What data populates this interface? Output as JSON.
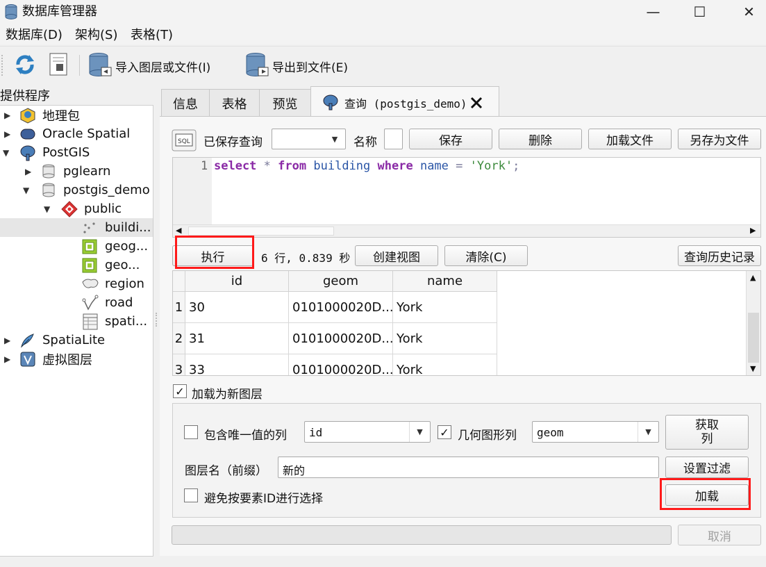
{
  "window": {
    "title": "数据库管理器",
    "minimize": "—",
    "maximize": "☐",
    "close": "✕"
  },
  "menu": [
    "数据库(D)",
    "架构(S)",
    "表格(T)"
  ],
  "toolbar": {
    "import_label": "导入图层或文件(I)",
    "export_label": "导出到文件(E)"
  },
  "tree": {
    "header": "提供程序",
    "items": [
      {
        "label": "地理包",
        "icon": "geopackage-icon"
      },
      {
        "label": "Oracle Spatial",
        "icon": "oracle-icon"
      },
      {
        "label": "PostGIS",
        "icon": "postgis-elephant-icon"
      },
      {
        "label": "pglearn",
        "icon": "database-icon"
      },
      {
        "label": "postgis_demo",
        "icon": "database-icon"
      },
      {
        "label": "public",
        "icon": "schema-icon"
      },
      {
        "label": "buildi...",
        "icon": "point-layer-icon"
      },
      {
        "label": "geog...",
        "icon": "raster-layer-icon"
      },
      {
        "label": "geo...",
        "icon": "raster-layer-icon"
      },
      {
        "label": "region",
        "icon": "polygon-layer-icon"
      },
      {
        "label": "road",
        "icon": "line-layer-icon"
      },
      {
        "label": "spati...",
        "icon": "table-icon"
      },
      {
        "label": "SpatiaLite",
        "icon": "feather-icon"
      },
      {
        "label": "虚拟图层",
        "icon": "virtual-layer-icon"
      }
    ]
  },
  "tabs": [
    "信息",
    "表格",
    "预览",
    "查询 (postgis_demo)"
  ],
  "query": {
    "saved_label": "已保存查询",
    "name_label": "名称",
    "save": "保存",
    "delete": "删除",
    "load_file": "加载文件",
    "save_as_file": "另存为文件",
    "line_number": "1",
    "sql": {
      "select": "select",
      "star": "*",
      "from": "from",
      "table": "building",
      "where": "where",
      "col": "name",
      "eq": "=",
      "value": "'York'",
      "semi": ";"
    },
    "execute": "执行",
    "status": "6 行, 0.839 秒",
    "create_view": "创建视图",
    "clear": "清除(C)",
    "history": "查询历史记录"
  },
  "results": {
    "columns": [
      "id",
      "geom",
      "name"
    ],
    "rows": [
      {
        "n": "1",
        "id": "30",
        "geom": "0101000020D...",
        "name": "York"
      },
      {
        "n": "2",
        "id": "31",
        "geom": "0101000020D...",
        "name": "York"
      },
      {
        "n": "3",
        "id": "33",
        "geom": "0101000020D...",
        "name": "York"
      }
    ]
  },
  "load": {
    "load_as_layer": "加载为新图层",
    "unique_col_label": "包含唯一值的列",
    "unique_col_value": "id",
    "geom_col_label": "几何图形列",
    "geom_col_value": "geom",
    "fetch_cols": "获取\n列",
    "layer_name_label": "图层名（前缀）",
    "layer_name_value": "新的",
    "set_filter": "设置过滤",
    "avoid_select_label": "避免按要素ID进行选择",
    "load_button": "加载",
    "cancel": "取消"
  },
  "colors": {
    "highlight": "#ff1a1a",
    "keyword": "#8a2aa6",
    "identifier": "#2a55a6",
    "string": "#3c8a3c"
  }
}
